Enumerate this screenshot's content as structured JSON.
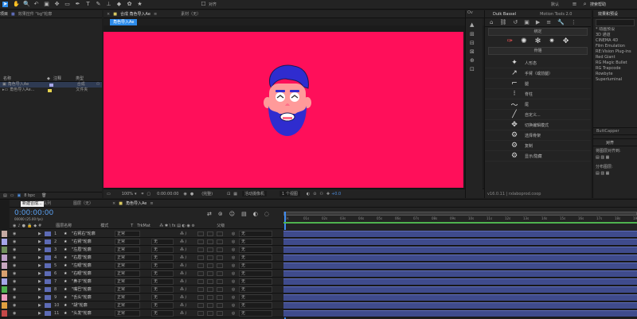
{
  "toolbar": {
    "snap_label": "对齐",
    "workspace": "默认",
    "search_placeholder": "搜索帮助"
  },
  "project": {
    "tab_label": "项目",
    "effect_controls_tab": "效果控件 \"bg\"轮廓",
    "col_name": "名称",
    "col_type": "类型",
    "items": [
      {
        "name": "角色导入Ae",
        "type": "合成",
        "color": "#a6a6e8"
      },
      {
        "name": "角色导入Ae...",
        "type": "文件夹",
        "color": "#e6d34e"
      }
    ],
    "bpc": "8 bpc"
  },
  "comp": {
    "panel_tab": "合成 角色导入Ae",
    "footage_tab": "素材（无）",
    "sub_tab": "角色导入Ae",
    "bg_color": "#ff0f5a",
    "zoom": "100%",
    "timecode": "0:00:00:00",
    "quality": "(完整)",
    "camera": "活动摄像机",
    "view": "1 个视图",
    "exposure": "+0.0"
  },
  "duik": {
    "tab_label": "Duik Bassel",
    "tab2": "Motion Tools 2.0",
    "bind_label": "绑定",
    "bones_label": "骨骼",
    "buttons": [
      "人形态",
      "手臂（或前腿）",
      "腿",
      "脊柱",
      "尾",
      "自定义...",
      "切换编辑模式",
      "选择骨架",
      "复制",
      "显示/隐藏"
    ],
    "version": "v16.0.11 | rxlaboprod.coop"
  },
  "effects": {
    "tab_label": "效果和预设",
    "items": [
      "* 动画预设",
      "3D 通道",
      "CINEMA 4D",
      "Film Emulation",
      "RE:Vision Plug-ins",
      "Red Giant",
      "RG Magic Bullet",
      "RG Trapcode",
      "Rowbyte",
      "Superluminal"
    ],
    "buttcapper": "ButtCapper",
    "align_tab": "对齐",
    "align_to": "将图层对齐到:",
    "distribute": "分布图层:"
  },
  "timeline": {
    "tabs": [
      "渲染队列",
      "图层（无）",
      "角色导入Ae"
    ],
    "timecode": "0:00:00:00",
    "fps": "00000 (25.00 fps)",
    "tooltip": "新建合成...",
    "col_layer_name": "图层名称",
    "col_mode": "模式",
    "col_t": "T",
    "col_trkmat": "TrkMat",
    "col_parent": "父级",
    "mode_normal": "正常",
    "none": "无",
    "ruler": [
      "0s",
      "01s",
      "02s",
      "03s",
      "04s",
      "05s",
      "06s",
      "07s",
      "08s",
      "09s",
      "10s",
      "11s",
      "12s",
      "13s",
      "14s",
      "15s",
      "16s",
      "17s",
      "18s",
      "19s"
    ],
    "layers": [
      {
        "num": "1",
        "name": "\"右臂右\"轮廓",
        "color": "#c5aaa4"
      },
      {
        "num": "2",
        "name": "\"右臂\"轮廓",
        "color": "#a6a6e8"
      },
      {
        "num": "3",
        "name": "\"左眉\"轮廓",
        "color": "#6f8f5a"
      },
      {
        "num": "4",
        "name": "\"右眉\"轮廓",
        "color": "#bfa0c8"
      },
      {
        "num": "5",
        "name": "\"左眼\"轮廓",
        "color": "#c8a8c0"
      },
      {
        "num": "6",
        "name": "\"右眼\"轮廓",
        "color": "#d8a070"
      },
      {
        "num": "7",
        "name": "\"鼻子\"轮廓",
        "color": "#a6a6e8"
      },
      {
        "num": "8",
        "name": "\"嘴巴\"轮廓",
        "color": "#4fb34f"
      },
      {
        "num": "9",
        "name": "\"舌头\"轮廓",
        "color": "#ee9ec0"
      },
      {
        "num": "10",
        "name": "\"胡\"轮廓",
        "color": "#e0a040"
      },
      {
        "num": "11",
        "name": "\"头发\"轮廓",
        "color": "#c54848"
      }
    ]
  }
}
